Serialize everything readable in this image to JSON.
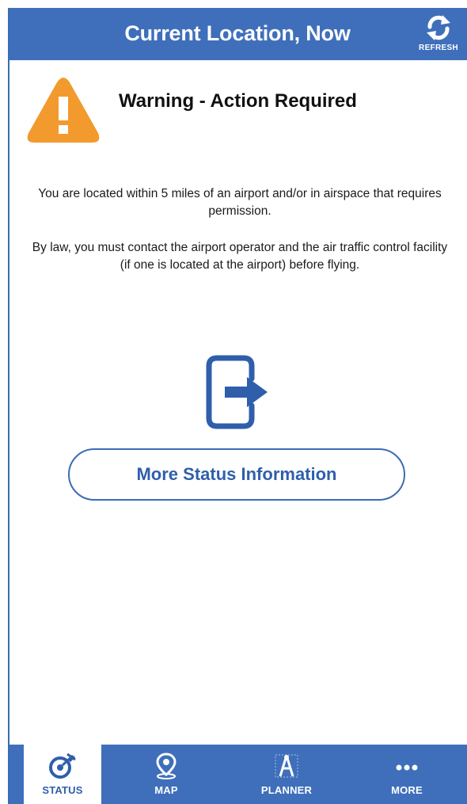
{
  "header": {
    "title": "Current Location, Now",
    "refresh_label": "REFRESH"
  },
  "warning": {
    "title": "Warning - Action Required",
    "message1": "You are located within 5 miles of an airport and/or in airspace that requires permission.",
    "message2": "By law, you must contact the airport operator and the air traffic control facility (if one is located at the airport) before flying."
  },
  "status_button": {
    "label": "More Status Information"
  },
  "tabs": [
    {
      "label": "STATUS",
      "icon": "status-icon"
    },
    {
      "label": "MAP",
      "icon": "map-pin-icon"
    },
    {
      "label": "PLANNER",
      "icon": "planner-icon"
    },
    {
      "label": "MORE",
      "icon": "more-icon"
    }
  ],
  "colors": {
    "brand": "#3f6fbb",
    "warning": "#f29a2e",
    "text": "#1a1a1a"
  }
}
